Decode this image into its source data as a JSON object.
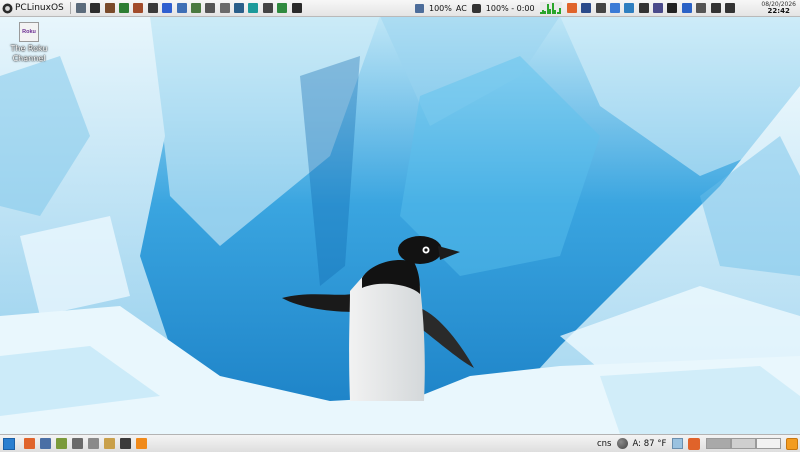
{
  "top_panel": {
    "menu_label": "PCLinuxOS",
    "launcher_icons": [
      {
        "name": "app-menu-icon",
        "color": "#5b6b7b"
      },
      {
        "name": "terminal-icon",
        "color": "#2c2c2c"
      },
      {
        "name": "settings-tools-icon",
        "color": "#7a4a2a"
      },
      {
        "name": "check-edit-icon",
        "color": "#2d7d32"
      },
      {
        "name": "package-icon",
        "color": "#a24b2a"
      },
      {
        "name": "disk-icon",
        "color": "#3a3a3a"
      },
      {
        "name": "circle-app-icon",
        "color": "#2f5fd0"
      },
      {
        "name": "window-icon",
        "color": "#3f6fb5"
      },
      {
        "name": "image-viewer-icon",
        "color": "#4b7a40"
      },
      {
        "name": "calculator-icon",
        "color": "#555555"
      },
      {
        "name": "wrench-icon",
        "color": "#6a6a6a"
      },
      {
        "name": "system-monitor-icon",
        "color": "#2a5f8a"
      },
      {
        "name": "network-icon",
        "color": "#1c9a9a"
      },
      {
        "name": "screenshot-icon",
        "color": "#444444"
      },
      {
        "name": "file-manager-icon",
        "color": "#2f8a3f"
      },
      {
        "name": "video-player-icon",
        "color": "#2a2a2a"
      }
    ],
    "tray": {
      "volume_percent": "100%",
      "ac_label": "AC",
      "battery_text": "100% - 0:00",
      "cpu_graph_levels": [
        0.2,
        0.3,
        0.25,
        0.8,
        0.4,
        0.9,
        0.3,
        0.2,
        0.5
      ]
    },
    "tray_icons": [
      {
        "name": "firefox-icon",
        "color": "#e0632a"
      },
      {
        "name": "vpn-shield-icon",
        "color": "#2b4a8a"
      },
      {
        "name": "download-icon",
        "color": "#444444"
      },
      {
        "name": "chromium-icon",
        "color": "#3a7ad6"
      },
      {
        "name": "globe-icon",
        "color": "#2f7fc0"
      },
      {
        "name": "omega-icon",
        "color": "#333333"
      },
      {
        "name": "messenger-icon",
        "color": "#4a4a8a"
      },
      {
        "name": "terminal-tray-icon",
        "color": "#222222"
      },
      {
        "name": "bluetooth-icon",
        "color": "#2a62c6"
      },
      {
        "name": "clipboard-icon",
        "color": "#555555"
      },
      {
        "name": "battery-icon",
        "color": "#333333"
      },
      {
        "name": "speaker-icon",
        "color": "#333333"
      }
    ],
    "clock": {
      "date": "08/20/2026",
      "time": "22:42"
    }
  },
  "desktop": {
    "icons": [
      {
        "label": "The Roku Channel",
        "badge": "Roku"
      }
    ]
  },
  "bottom_panel": {
    "taskbar_icons": [
      {
        "name": "firefox-taskbar-icon",
        "color": "#e0632a"
      },
      {
        "name": "mail-icon",
        "color": "#4a6fa5"
      },
      {
        "name": "editor-icon",
        "color": "#7a9a3a"
      },
      {
        "name": "image-taskbar-icon",
        "color": "#6a6a6a"
      },
      {
        "name": "settings-taskbar-icon",
        "color": "#8a8a8a"
      },
      {
        "name": "folder-icon",
        "color": "#c9a04a"
      },
      {
        "name": "terminal-taskbar-icon",
        "color": "#3a3a3a"
      },
      {
        "name": "vlc-icon",
        "color": "#f08a1a"
      }
    ],
    "layout_indicator": "cns",
    "weather": "A: 87 °F",
    "pager_desktops": 3
  }
}
